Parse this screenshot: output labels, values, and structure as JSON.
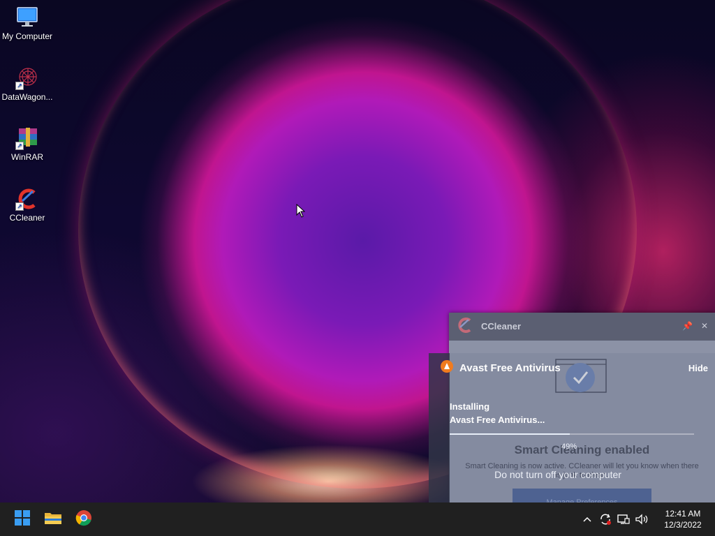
{
  "desktop": {
    "icons": [
      {
        "label": "My Computer",
        "icon": "monitor-icon"
      },
      {
        "label": "DataWagon...",
        "icon": "datawagon-icon"
      },
      {
        "label": "WinRAR",
        "icon": "winrar-icon"
      },
      {
        "label": "CCleaner",
        "icon": "ccleaner-icon"
      }
    ]
  },
  "ccleaner": {
    "app_name": "CCleaner",
    "headline": "Smart Cleaning enabled",
    "message": "Smart Cleaning is now active. CCleaner will let you know when there is junk to clean.",
    "button_label": "Manage Preferences",
    "colors": {
      "panel": "#5b5f72",
      "body": "#8c92a6",
      "button": "#35508f"
    }
  },
  "avast": {
    "title": "Avast Free Antivirus",
    "hide_label": "Hide",
    "status_line1": "Installing",
    "status_line2": "Avast Free Antivirus...",
    "progress_text": "49%",
    "progress": 0.49,
    "warning": "Do not turn off your computer",
    "colors": {
      "accent": "#f07b1f"
    }
  },
  "taskbar": {
    "apps": [
      {
        "name": "Start",
        "icon": "windows-start-icon"
      },
      {
        "name": "File Explorer",
        "icon": "folder-icon"
      },
      {
        "name": "Google Chrome",
        "icon": "chrome-icon"
      }
    ],
    "tray": {
      "time": "12:41 AM",
      "date": "12/3/2022"
    }
  }
}
